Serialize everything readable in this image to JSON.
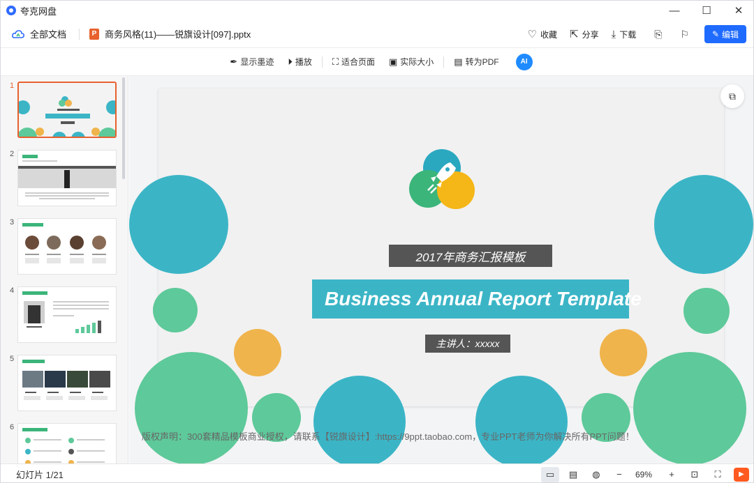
{
  "app": {
    "title": "夸克网盘"
  },
  "window_controls": {
    "minimize": "—",
    "maximize": "☐",
    "close": "✕"
  },
  "header": {
    "all_docs": "全部文档",
    "file_name": "商务风格(11)——锐旗设计[097].pptx",
    "ppt_badge": "P",
    "actions": {
      "favorite": "收藏",
      "share": "分享",
      "download": "下载",
      "edit": "编辑"
    }
  },
  "toolbar": {
    "show_ink": "显示墨迹",
    "play": "播放",
    "fit_page": "适合页面",
    "actual_size": "实际大小",
    "to_pdf": "转为PDF",
    "ai": "AI"
  },
  "thumbnails": [
    "1",
    "2",
    "3",
    "4",
    "5",
    "6"
  ],
  "slide": {
    "subtitle": "2017年商务汇报模板",
    "title": "Business  Annual  Report Template",
    "presenter": "主讲人：xxxxx"
  },
  "copyright": "版权声明：300套精品模板商业授权，请联系【锐旗设计】:https://9ppt.taobao.com，专业PPT老师为你解决所有PPT问题！",
  "status": {
    "slide_count": "幻灯片 1/21",
    "zoom": "69%"
  },
  "colors": {
    "accent": "#1f6bff",
    "teal": "#3bb5c6",
    "green": "#5ec99a",
    "orange": "#f0b44c",
    "ppt_orange": "#e8612d"
  }
}
